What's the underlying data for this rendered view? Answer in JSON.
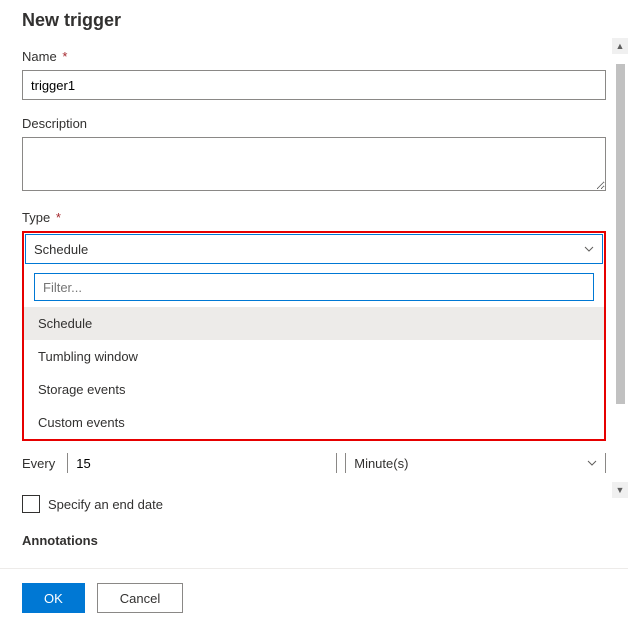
{
  "title": "New trigger",
  "fields": {
    "name": {
      "label": "Name",
      "required": "*",
      "value": "trigger1"
    },
    "description": {
      "label": "Description",
      "value": ""
    },
    "type": {
      "label": "Type",
      "required": "*",
      "selected": "Schedule"
    },
    "every": {
      "label": "Every",
      "value": "15",
      "unit": "Minute(s)"
    },
    "endDate": {
      "label": "Specify an end date"
    },
    "annotations": {
      "label": "Annotations"
    }
  },
  "typeDropdown": {
    "filterPlaceholder": "Filter...",
    "options": [
      "Schedule",
      "Tumbling window",
      "Storage events",
      "Custom events"
    ]
  },
  "footer": {
    "ok": "OK",
    "cancel": "Cancel"
  }
}
